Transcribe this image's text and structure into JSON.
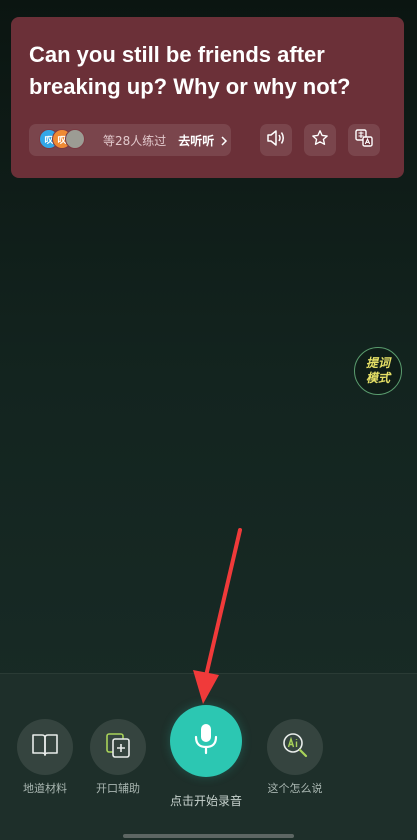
{
  "question_card": {
    "question_text": "Can you still be friends after breaking up? Why or why not?",
    "practice": {
      "avatar_1": "叹",
      "avatar_2": "叹",
      "count_text": "等28人练过",
      "listen_link": "去听听"
    },
    "icons": [
      "speaker-icon",
      "star-icon",
      "translate-icon"
    ]
  },
  "prompt_mode": {
    "line1": "提词",
    "line2": "模式"
  },
  "bottom_toolbar": {
    "tools": [
      {
        "label": "地道材料",
        "icon": "book-icon"
      },
      {
        "label": "开口辅助",
        "icon": "add-card-icon"
      },
      {
        "label": "这个怎么说",
        "icon": "ai-search-icon"
      }
    ],
    "record_label": "点击开始录音"
  },
  "colors": {
    "card_bg": "#6b3038",
    "record_button": "#2cc7b2",
    "prompt_mode_text": "#e6e066",
    "annotation_arrow": "#f03a3a"
  }
}
